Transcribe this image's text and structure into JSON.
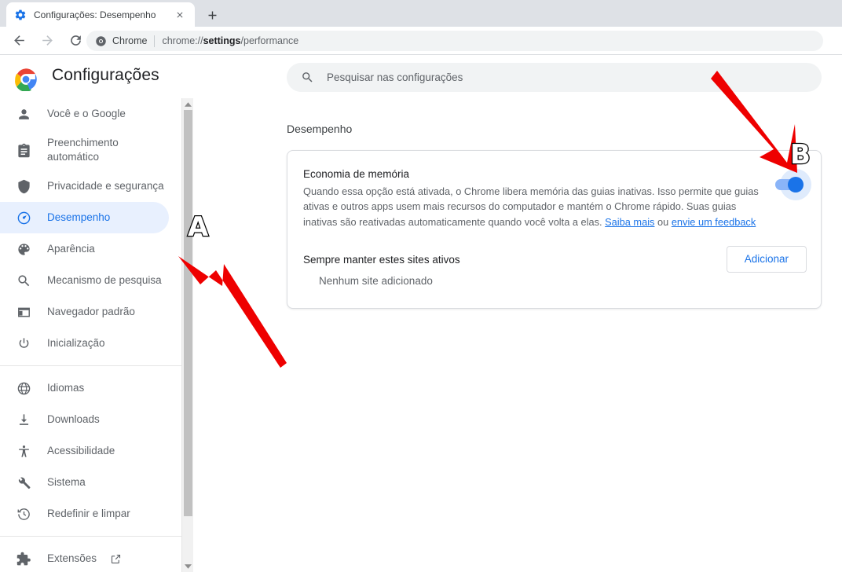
{
  "browser": {
    "tab": {
      "title": "Configurações: Desempenho",
      "favicon_icon": "gear-icon",
      "close_icon": "close-icon"
    },
    "new_tab_label": "+",
    "nav": {
      "back_icon": "arrow-left-icon",
      "forward_icon": "arrow-right-icon",
      "reload_icon": "reload-icon"
    },
    "omnibox": {
      "chip_icon": "chrome-icon",
      "chip_label": "Chrome",
      "url_prefix": "chrome://",
      "url_bold": "settings",
      "url_suffix": "/performance"
    }
  },
  "header": {
    "logo_icon": "chrome-logo-icon",
    "title": "Configurações",
    "search": {
      "icon": "search-icon",
      "placeholder": "Pesquisar nas configurações",
      "value": ""
    }
  },
  "sidebar": {
    "groups": [
      {
        "items": [
          {
            "label": "Você e o Google",
            "icon": "person-icon",
            "active": false
          },
          {
            "label": "Preenchimento automático",
            "icon": "clipboard-icon",
            "active": false
          },
          {
            "label": "Privacidade e segurança",
            "icon": "shield-icon",
            "active": false
          },
          {
            "label": "Desempenho",
            "icon": "speedometer-icon",
            "active": true
          },
          {
            "label": "Aparência",
            "icon": "palette-icon",
            "active": false
          },
          {
            "label": "Mecanismo de pesquisa",
            "icon": "search-icon",
            "active": false
          },
          {
            "label": "Navegador padrão",
            "icon": "browser-window-icon",
            "active": false
          },
          {
            "label": "Inicialização",
            "icon": "power-icon",
            "active": false
          }
        ]
      },
      {
        "items": [
          {
            "label": "Idiomas",
            "icon": "globe-icon",
            "active": false
          },
          {
            "label": "Downloads",
            "icon": "download-icon",
            "active": false
          },
          {
            "label": "Acessibilidade",
            "icon": "accessibility-icon",
            "active": false
          },
          {
            "label": "Sistema",
            "icon": "wrench-icon",
            "active": false
          },
          {
            "label": "Redefinir e limpar",
            "icon": "history-restore-icon",
            "active": false
          }
        ]
      },
      {
        "items": [
          {
            "label": "Extensões",
            "icon": "extension-icon",
            "external_icon": "open-in-new-icon",
            "active": false
          }
        ]
      }
    ],
    "scrollbar": {
      "up_arrow_icon": "chevron-up-icon",
      "down_arrow_icon": "chevron-down-icon"
    }
  },
  "main": {
    "section_title": "Desempenho",
    "memory_saver": {
      "title": "Economia de memória",
      "description_part1": "Quando essa opção está ativada, o Chrome libera memória das guias inativas. Isso permite que guias ativas e outros apps usem mais recursos do computador e mantém o Chrome rápido. Suas guias inativas são reativadas automaticamente quando você volta a elas. ",
      "link_learn_more": "Saiba mais",
      "description_conjunction": " ou ",
      "link_feedback": "envie um feedback",
      "toggle_state": "on"
    },
    "keep_sites_active": {
      "label": "Sempre manter estes sites ativos",
      "add_button": "Adicionar",
      "empty_message": "Nenhum site adicionado"
    }
  },
  "annotations": {
    "marker_a": "A",
    "marker_b": "B",
    "arrow_color": "#ee0000"
  },
  "colors": {
    "accent": "#1a73e8",
    "active_nav_bg": "#e8f0fe",
    "toggle_on": "#8ab4f8",
    "text_primary": "#202124",
    "text_secondary": "#5f6368",
    "annotation_red": "#ee0000"
  }
}
